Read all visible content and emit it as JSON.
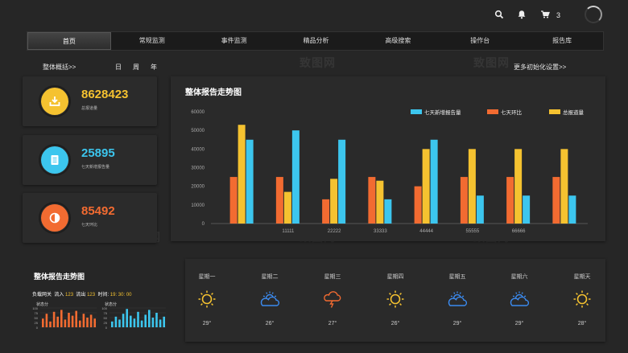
{
  "top": {
    "cart_count": "3"
  },
  "nav": [
    "首页",
    "常规监测",
    "事件监测",
    "精品分析",
    "高级搜索",
    "操作台",
    "报告库"
  ],
  "subheader": {
    "overview_link": "整体概括>>",
    "tab_day": "日",
    "tab_week": "周",
    "tab_year": "年",
    "more_settings": "更多初始化设置>>"
  },
  "kpis": [
    {
      "value": "8628423",
      "label": "总报道量",
      "color": "#f5c230",
      "icon": "download-icon"
    },
    {
      "value": "25895",
      "label": "七天新增报告量",
      "color": "#3cc6ee",
      "icon": "document-icon"
    },
    {
      "value": "85492",
      "label": "七天环比",
      "color": "#f26b31",
      "icon": "contrast-icon"
    }
  ],
  "chart_title": "整体报告走势图",
  "chart_data": {
    "type": "bar",
    "categories": [
      "",
      "11111",
      "22222",
      "33333",
      "44444",
      "55555",
      "66666",
      ""
    ],
    "series": [
      {
        "name": "七天环比",
        "color": "#f26b31",
        "values": [
          25000,
          25000,
          13000,
          25000,
          20000,
          25000,
          25000,
          25000
        ]
      },
      {
        "name": "总报道量",
        "color": "#f5c230",
        "values": [
          53000,
          17000,
          24000,
          23000,
          40000,
          40000,
          40000,
          40000
        ]
      },
      {
        "name": "七天新增报告量",
        "color": "#3cc6ee",
        "values": [
          45000,
          50000,
          45000,
          13000,
          45000,
          15000,
          15000,
          15000
        ]
      }
    ],
    "legend_order": [
      "七天新增报告量",
      "七天环比",
      "总报道量"
    ],
    "yticks": [
      "0",
      "10000",
      "20000",
      "30000",
      "40000",
      "50000",
      "60000"
    ],
    "ylim": [
      0,
      60000
    ],
    "legend_position": "top-right"
  },
  "bottom_left": {
    "title": "整体报告走势图",
    "status_label": "负载网关",
    "in_label": "流入",
    "in_value": "123",
    "out_label": "流出",
    "out_value": "123",
    "time_label": "时间:",
    "time_value": "19: 30: 00",
    "mini_chart_title": "状态分",
    "mini_ticks": [
      "100",
      "75",
      "50",
      "25",
      "0"
    ],
    "mini_left": [
      45,
      70,
      30,
      80,
      55,
      90,
      40,
      75,
      60,
      85,
      35,
      70,
      50,
      65,
      45
    ],
    "mini_right": [
      30,
      55,
      40,
      70,
      95,
      60,
      45,
      80,
      35,
      65,
      90,
      50,
      75,
      40,
      55
    ]
  },
  "weather": [
    {
      "day": "星期一",
      "temp": "29°",
      "icon": "sun-icon"
    },
    {
      "day": "星期二",
      "temp": "26°",
      "icon": "partly-cloudy-icon"
    },
    {
      "day": "星期三",
      "temp": "27°",
      "icon": "thunderstorm-icon"
    },
    {
      "day": "星期四",
      "temp": "26°",
      "icon": "sun-icon"
    },
    {
      "day": "星期五",
      "temp": "29°",
      "icon": "partly-cloudy-icon"
    },
    {
      "day": "星期六",
      "temp": "29°",
      "icon": "partly-cloudy-icon"
    },
    {
      "day": "星期天",
      "temp": "28°",
      "icon": "sun-icon"
    }
  ],
  "watermark": "致图网"
}
